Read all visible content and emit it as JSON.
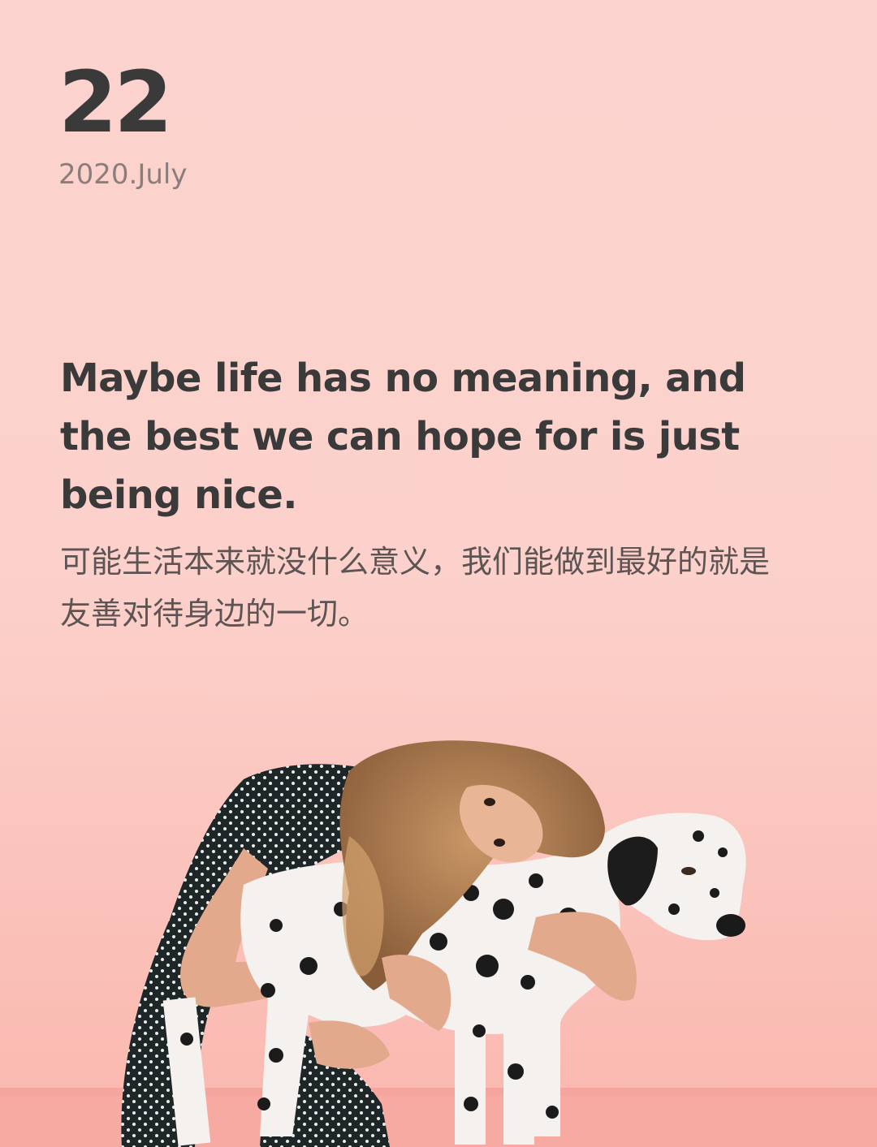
{
  "date": {
    "day": "22",
    "month_year": "2020.July"
  },
  "quote": {
    "english": "Maybe life has no meaning, and the best we can hope for is just being nice.",
    "chinese": "可能生活本来就没什么意义，我们能做到最好的就是友善对待身边的一切。"
  },
  "colors": {
    "background": "#fcd3ce",
    "text_dark": "#3b3a3a",
    "text_muted": "#8b7d7c",
    "wall_lower": "#f9b7ae"
  }
}
